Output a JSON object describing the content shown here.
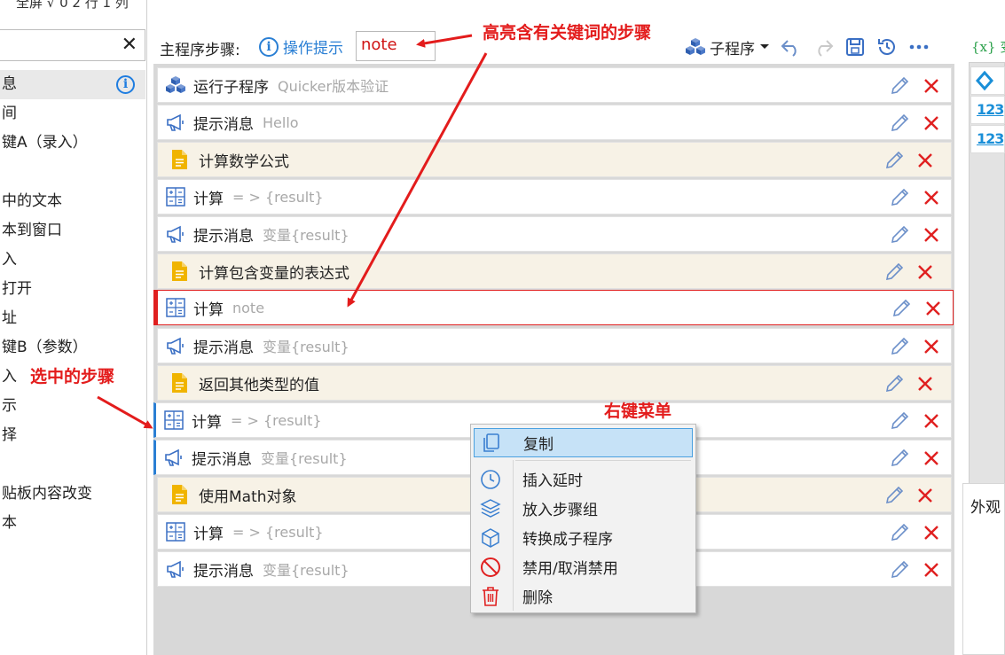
{
  "left_panel": {
    "top_clipped_text": "全屏 √ 0 2 行 1 列",
    "search_value": "",
    "close_icon": "close-icon",
    "items": [
      {
        "label": "息",
        "has_info": true
      },
      {
        "label": "间"
      },
      {
        "label": "键A（录入）"
      },
      {
        "label": ""
      },
      {
        "label": "中的文本"
      },
      {
        "label": "本到窗口"
      },
      {
        "label": "入"
      },
      {
        "label": "打开"
      },
      {
        "label": "址"
      },
      {
        "label": "键B（参数）"
      },
      {
        "label": "入"
      },
      {
        "label": "示"
      },
      {
        "label": "择"
      },
      {
        "label": ""
      },
      {
        "label": "贴板内容改变"
      },
      {
        "label": "本"
      }
    ]
  },
  "header": {
    "main_steps_label": "主程序步骤:",
    "hint_label": "操作提示",
    "search_value": "note",
    "subprogram_label": "子程序"
  },
  "steps": [
    {
      "kind": "run-sub",
      "title": "运行子程序",
      "sub": "Quicker版本验证"
    },
    {
      "kind": "notify",
      "title": "提示消息",
      "sub": "Hello"
    },
    {
      "kind": "note",
      "title": "计算数学公式",
      "sub": ""
    },
    {
      "kind": "calc",
      "title": "计算",
      "sub": "= > {result}"
    },
    {
      "kind": "notify",
      "title": "提示消息",
      "sub": "变量{result}"
    },
    {
      "kind": "note",
      "title": "计算包含变量的表达式",
      "sub": ""
    },
    {
      "kind": "calc",
      "title": "计算",
      "sub": "note",
      "highlight": true
    },
    {
      "kind": "notify",
      "title": "提示消息",
      "sub": "变量{result}"
    },
    {
      "kind": "note",
      "title": "返回其他类型的值",
      "sub": ""
    },
    {
      "kind": "calc",
      "title": "计算",
      "sub": "= > {result}",
      "selected": true
    },
    {
      "kind": "notify",
      "title": "提示消息",
      "sub": "变量{result}",
      "selected": true
    },
    {
      "kind": "note",
      "title": "使用Math对象",
      "sub": ""
    },
    {
      "kind": "calc",
      "title": "计算",
      "sub": "= > {result}"
    },
    {
      "kind": "notify",
      "title": "提示消息",
      "sub": "变量{result}"
    }
  ],
  "context_menu": {
    "items": [
      {
        "label": "复制",
        "icon": "copy-icon"
      },
      {
        "label": "插入延时",
        "icon": "clock-icon"
      },
      {
        "label": "放入步骤组",
        "icon": "layers-icon"
      },
      {
        "label": "转换成子程序",
        "icon": "cube-icon"
      },
      {
        "label": "禁用/取消禁用",
        "icon": "ban-icon"
      },
      {
        "label": "删除",
        "icon": "trash-icon"
      }
    ]
  },
  "right_panel": {
    "var_header": "{x} 变",
    "var_items": [
      "",
      "123",
      "123"
    ],
    "appearance_label": "外观"
  },
  "annotations": {
    "highlight_keyword": "高亮含有关键词的步骤",
    "selected_step": "选中的步骤",
    "right_click_menu": "右键菜单"
  },
  "colors": {
    "accent_blue": "#2a7fd4",
    "delete_red": "#e02020",
    "annotation_red": "#e31c1c",
    "note_bg": "#f7f2e6",
    "menu_highlight": "#c6e2f7"
  }
}
